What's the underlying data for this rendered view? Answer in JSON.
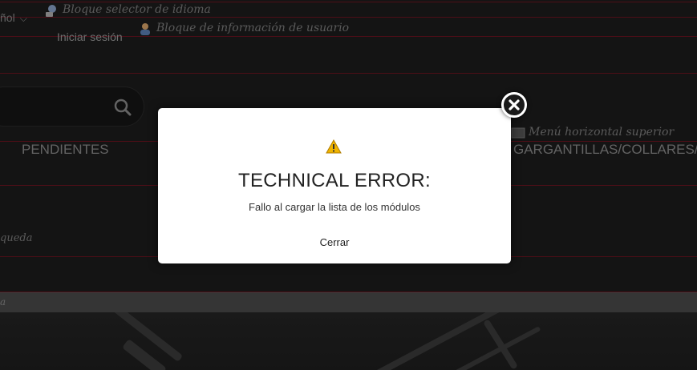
{
  "header": {
    "language_current": "ñol",
    "language_module_label": "Bloque selector de idioma",
    "login_label": "Iniciar sesión",
    "user_info_module_label": "Bloque de información de usuario"
  },
  "menu": {
    "module_label": "Menú horizontal superior",
    "items": [
      "PENDIENTES",
      "GARGANTILLAS/COLLARES/CO"
    ]
  },
  "search": {
    "module_label_fragment": "queda"
  },
  "breadcrumb_fragment": "a",
  "modal": {
    "title": "TECHNICAL ERROR:",
    "message": "Fallo al cargar la lista de los módulos",
    "close_link": "Cerrar"
  },
  "colors": {
    "divider": "#6b1420",
    "warning": "#f0b400",
    "modal_bg": "#ffffff"
  },
  "icons": [
    "language-module-icon",
    "user-module-icon",
    "search-icon",
    "menu-module-icon",
    "warning-icon",
    "close-icon"
  ]
}
